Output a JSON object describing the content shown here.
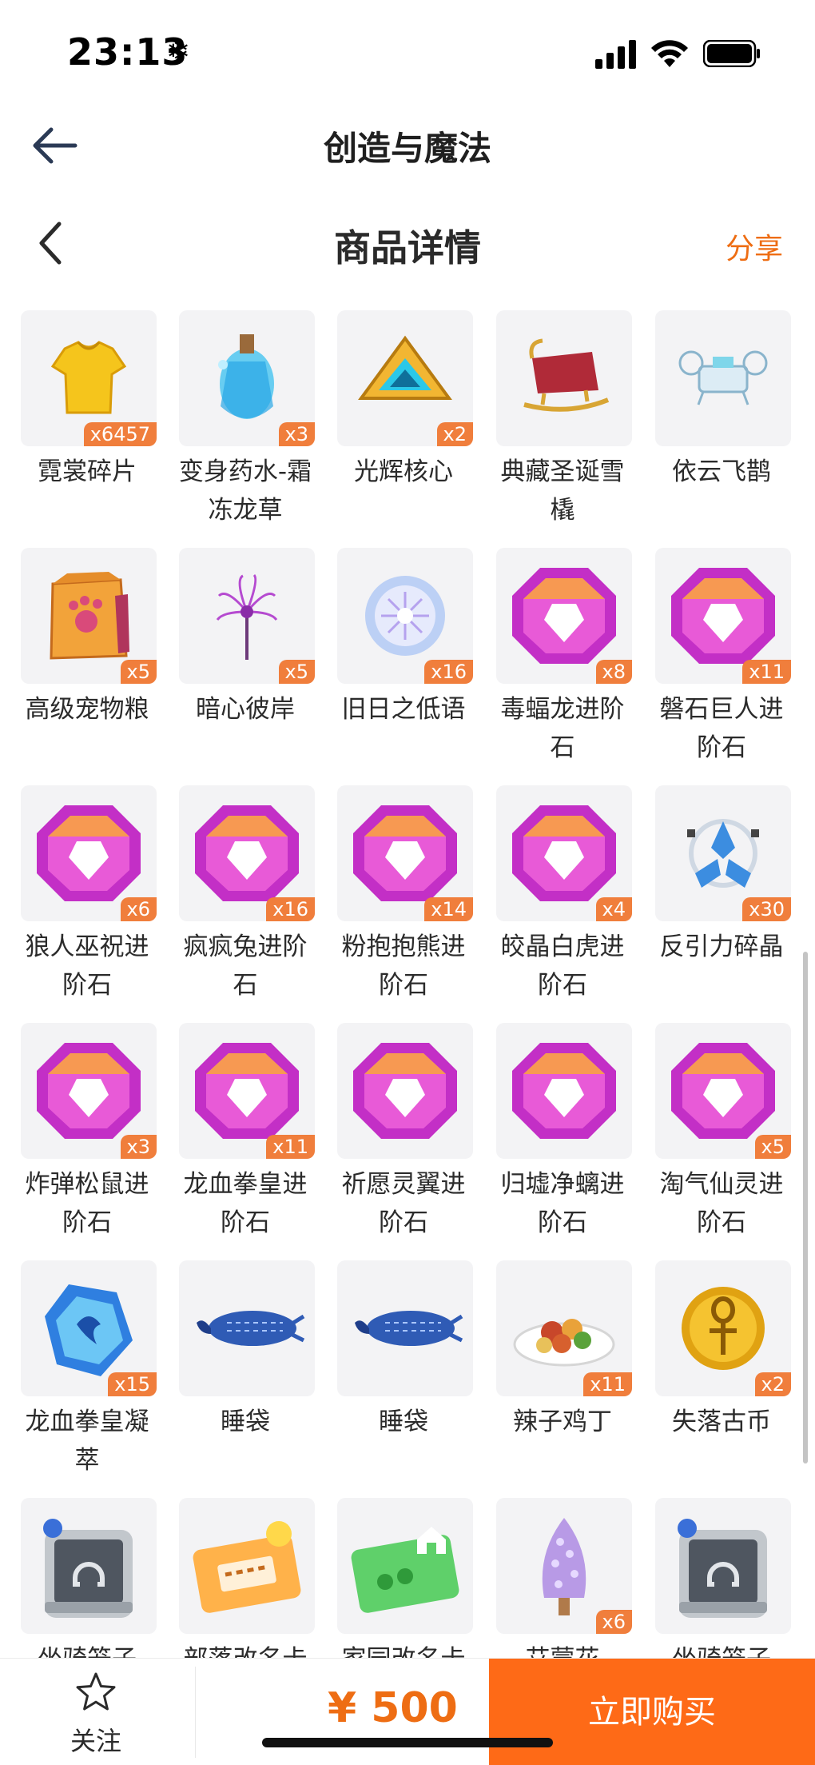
{
  "status": {
    "time": "23:13",
    "snow": "❄"
  },
  "app": {
    "title": "创造与魔法"
  },
  "header": {
    "title": "商品详情",
    "share": "分享"
  },
  "items": [
    {
      "name": "霓裳碎片",
      "count": "x6457",
      "icon": "shirt"
    },
    {
      "name": "变身药水-霜冻龙草",
      "count": "x3",
      "icon": "potion"
    },
    {
      "name": "光辉核心",
      "count": "x2",
      "icon": "core"
    },
    {
      "name": "典藏圣诞雪橇",
      "count": "",
      "icon": "sleigh"
    },
    {
      "name": "依云飞鹊",
      "count": "",
      "icon": "drone"
    },
    {
      "name": "高级宠物粮",
      "count": "x5",
      "icon": "food-bag"
    },
    {
      "name": "暗心彼岸",
      "count": "x5",
      "icon": "flower"
    },
    {
      "name": "旧日之低语",
      "count": "x16",
      "icon": "orb"
    },
    {
      "name": "毒蝠龙进阶石",
      "count": "x8",
      "icon": "gem"
    },
    {
      "name": "磐石巨人进阶石",
      "count": "x11",
      "icon": "gem"
    },
    {
      "name": "狼人巫祝进阶石",
      "count": "x6",
      "icon": "gem"
    },
    {
      "name": "疯疯兔进阶石",
      "count": "x16",
      "icon": "gem"
    },
    {
      "name": "粉抱抱熊进阶石",
      "count": "x14",
      "icon": "gem"
    },
    {
      "name": "皎晶白虎进阶石",
      "count": "x4",
      "icon": "gem"
    },
    {
      "name": "反引力碎晶",
      "count": "x30",
      "icon": "crystal"
    },
    {
      "name": "炸弹松鼠进阶石",
      "count": "x3",
      "icon": "gem"
    },
    {
      "name": "龙血拳皇进阶石",
      "count": "x11",
      "icon": "gem"
    },
    {
      "name": "祈愿灵翼进阶石",
      "count": "",
      "icon": "gem"
    },
    {
      "name": "归墟净螭进阶石",
      "count": "",
      "icon": "gem"
    },
    {
      "name": "淘气仙灵进阶石",
      "count": "x5",
      "icon": "gem"
    },
    {
      "name": "龙血拳皇凝萃",
      "count": "x15",
      "icon": "blue-crystal"
    },
    {
      "name": "睡袋",
      "count": "",
      "icon": "sleeping-bag"
    },
    {
      "name": "睡袋",
      "count": "",
      "icon": "sleeping-bag"
    },
    {
      "name": "辣子鸡丁",
      "count": "x11",
      "icon": "dish"
    },
    {
      "name": "失落古币",
      "count": "x2",
      "icon": "coin"
    },
    {
      "name": "坐骑笼子",
      "count": "",
      "icon": "cage"
    },
    {
      "name": "部落改名卡",
      "count": "",
      "icon": "card-orange"
    },
    {
      "name": "家园改名卡",
      "count": "",
      "icon": "card-green"
    },
    {
      "name": "艾蒙花",
      "count": "x6",
      "icon": "hyacinth"
    },
    {
      "name": "坐骑笼子",
      "count": "",
      "icon": "cage"
    }
  ],
  "bottom": {
    "follow": "关注",
    "price": "¥ 500",
    "buy": "立即购买"
  },
  "colors": {
    "accent": "#fe6a17",
    "badge": "#f07e3c"
  }
}
